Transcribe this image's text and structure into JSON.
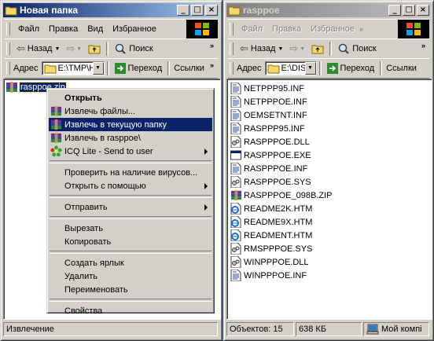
{
  "left_window": {
    "title": "Новая папка",
    "menu": [
      "Файл",
      "Правка",
      "Вид",
      "Избранное"
    ],
    "toolbar": {
      "back": "Назад",
      "search": "Поиск"
    },
    "address": {
      "label": "Адрес",
      "value": "E:\\TMP\\H",
      "go": "Переход",
      "links": "Ссылки"
    },
    "selected_file": "rasppoe.zip",
    "status": "Извлечение"
  },
  "right_window": {
    "title": "rasppoe",
    "menu": [
      "Файл",
      "Правка",
      "Избранное"
    ],
    "toolbar": {
      "back": "Назад",
      "search": "Поиск"
    },
    "address": {
      "label": "Адрес",
      "value": "E:\\DIS",
      "go": "Переход",
      "links": "Ссылки"
    },
    "files": [
      {
        "name": "NETPPP95.INF",
        "icon": "inf-file-icon"
      },
      {
        "name": "NETPPPOE.INF",
        "icon": "inf-file-icon"
      },
      {
        "name": "OEMSETNT.INF",
        "icon": "inf-file-icon"
      },
      {
        "name": "RASPPP95.INF",
        "icon": "inf-file-icon"
      },
      {
        "name": "RASPPPOE.DLL",
        "icon": "dll-file-icon"
      },
      {
        "name": "RASPPPOE.EXE",
        "icon": "exe-file-icon"
      },
      {
        "name": "RASPPPOE.INF",
        "icon": "inf-file-icon"
      },
      {
        "name": "RASPPPOE.SYS",
        "icon": "sys-file-icon"
      },
      {
        "name": "RASPPPOE_098B.ZIP",
        "icon": "winrar-archive-icon"
      },
      {
        "name": "README2K.HTM",
        "icon": "ie-document-icon"
      },
      {
        "name": "README9X.HTM",
        "icon": "ie-document-icon"
      },
      {
        "name": "READMENT.HTM",
        "icon": "ie-document-icon"
      },
      {
        "name": "RMSPPPOE.SYS",
        "icon": "sys-file-icon"
      },
      {
        "name": "WINPPPOE.DLL",
        "icon": "dll-file-icon"
      },
      {
        "name": "WINPPPOE.INF",
        "icon": "inf-file-icon"
      }
    ],
    "status": {
      "objects": "Объектов: 15",
      "size": "638 КБ",
      "location": "Мой компі"
    }
  },
  "context_menu": {
    "items": [
      {
        "label": "Открыть",
        "bold": true
      },
      {
        "label": "Извлечь файлы...",
        "icon": "winrar-icon"
      },
      {
        "label": "Извлечь в текущую папку",
        "icon": "winrar-icon",
        "highlighted": true
      },
      {
        "label": "Извлечь в rasppoe\\",
        "icon": "winrar-icon"
      },
      {
        "label": "ICQ Lite - Send to user",
        "icon": "icq-flower-icon",
        "submenu": true
      },
      {
        "sep": true
      },
      {
        "label": "Проверить на наличие вирусов..."
      },
      {
        "label": "Открыть с помощью",
        "submenu": true
      },
      {
        "sep": true
      },
      {
        "label": "Отправить",
        "submenu": true
      },
      {
        "sep": true
      },
      {
        "label": "Вырезать"
      },
      {
        "label": "Копировать"
      },
      {
        "sep": true
      },
      {
        "label": "Создать ярлык"
      },
      {
        "label": "Удалить"
      },
      {
        "label": "Переименовать"
      },
      {
        "sep": true
      },
      {
        "label": "Свойства"
      }
    ]
  },
  "colors": {
    "title_active": "#0a246a",
    "desktop": "#3a6ea5",
    "face": "#d4d0c8"
  }
}
